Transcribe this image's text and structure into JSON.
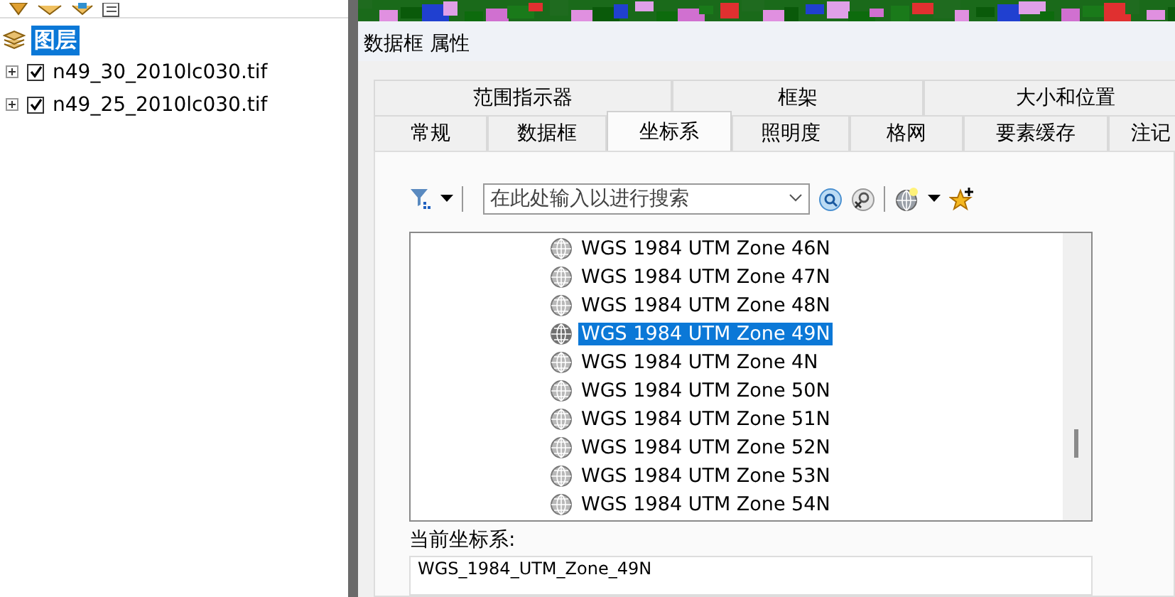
{
  "layers_panel": {
    "root": {
      "label": "图层",
      "selected": true
    },
    "layers": [
      {
        "name": "n49_30_2010lc030.tif",
        "checked": true,
        "expanded": false
      },
      {
        "name": "n49_25_2010lc030.tif",
        "checked": true,
        "expanded": false
      }
    ]
  },
  "dialog": {
    "title": "数据框 属性",
    "tab_rows": [
      [
        {
          "label": "范围指示器",
          "selected": false
        },
        {
          "label": "框架",
          "selected": false
        },
        {
          "label": "大小和位置",
          "selected": false
        }
      ],
      [
        {
          "label": "常规",
          "selected": false
        },
        {
          "label": "数据框",
          "selected": false
        },
        {
          "label": "坐标系",
          "selected": true
        },
        {
          "label": "照明度",
          "selected": false
        },
        {
          "label": "格网",
          "selected": false
        },
        {
          "label": "要素缓存",
          "selected": false
        },
        {
          "label": "注记",
          "selected": false
        }
      ]
    ],
    "search": {
      "placeholder": "在此处输入以进行搜索"
    },
    "coordinate_systems": [
      {
        "name": "WGS 1984 UTM Zone 46N",
        "selected": false
      },
      {
        "name": "WGS 1984 UTM Zone 47N",
        "selected": false
      },
      {
        "name": "WGS 1984 UTM Zone 48N",
        "selected": false
      },
      {
        "name": "WGS 1984 UTM Zone 49N",
        "selected": true
      },
      {
        "name": "WGS 1984 UTM Zone 4N",
        "selected": false
      },
      {
        "name": "WGS 1984 UTM Zone 50N",
        "selected": false
      },
      {
        "name": "WGS 1984 UTM Zone 51N",
        "selected": false
      },
      {
        "name": "WGS 1984 UTM Zone 52N",
        "selected": false
      },
      {
        "name": "WGS 1984 UTM Zone 53N",
        "selected": false
      },
      {
        "name": "WGS 1984 UTM Zone 54N",
        "selected": false
      }
    ],
    "current_label": "当前坐标系:",
    "current_value": "WGS_1984_UTM_Zone_49N"
  }
}
